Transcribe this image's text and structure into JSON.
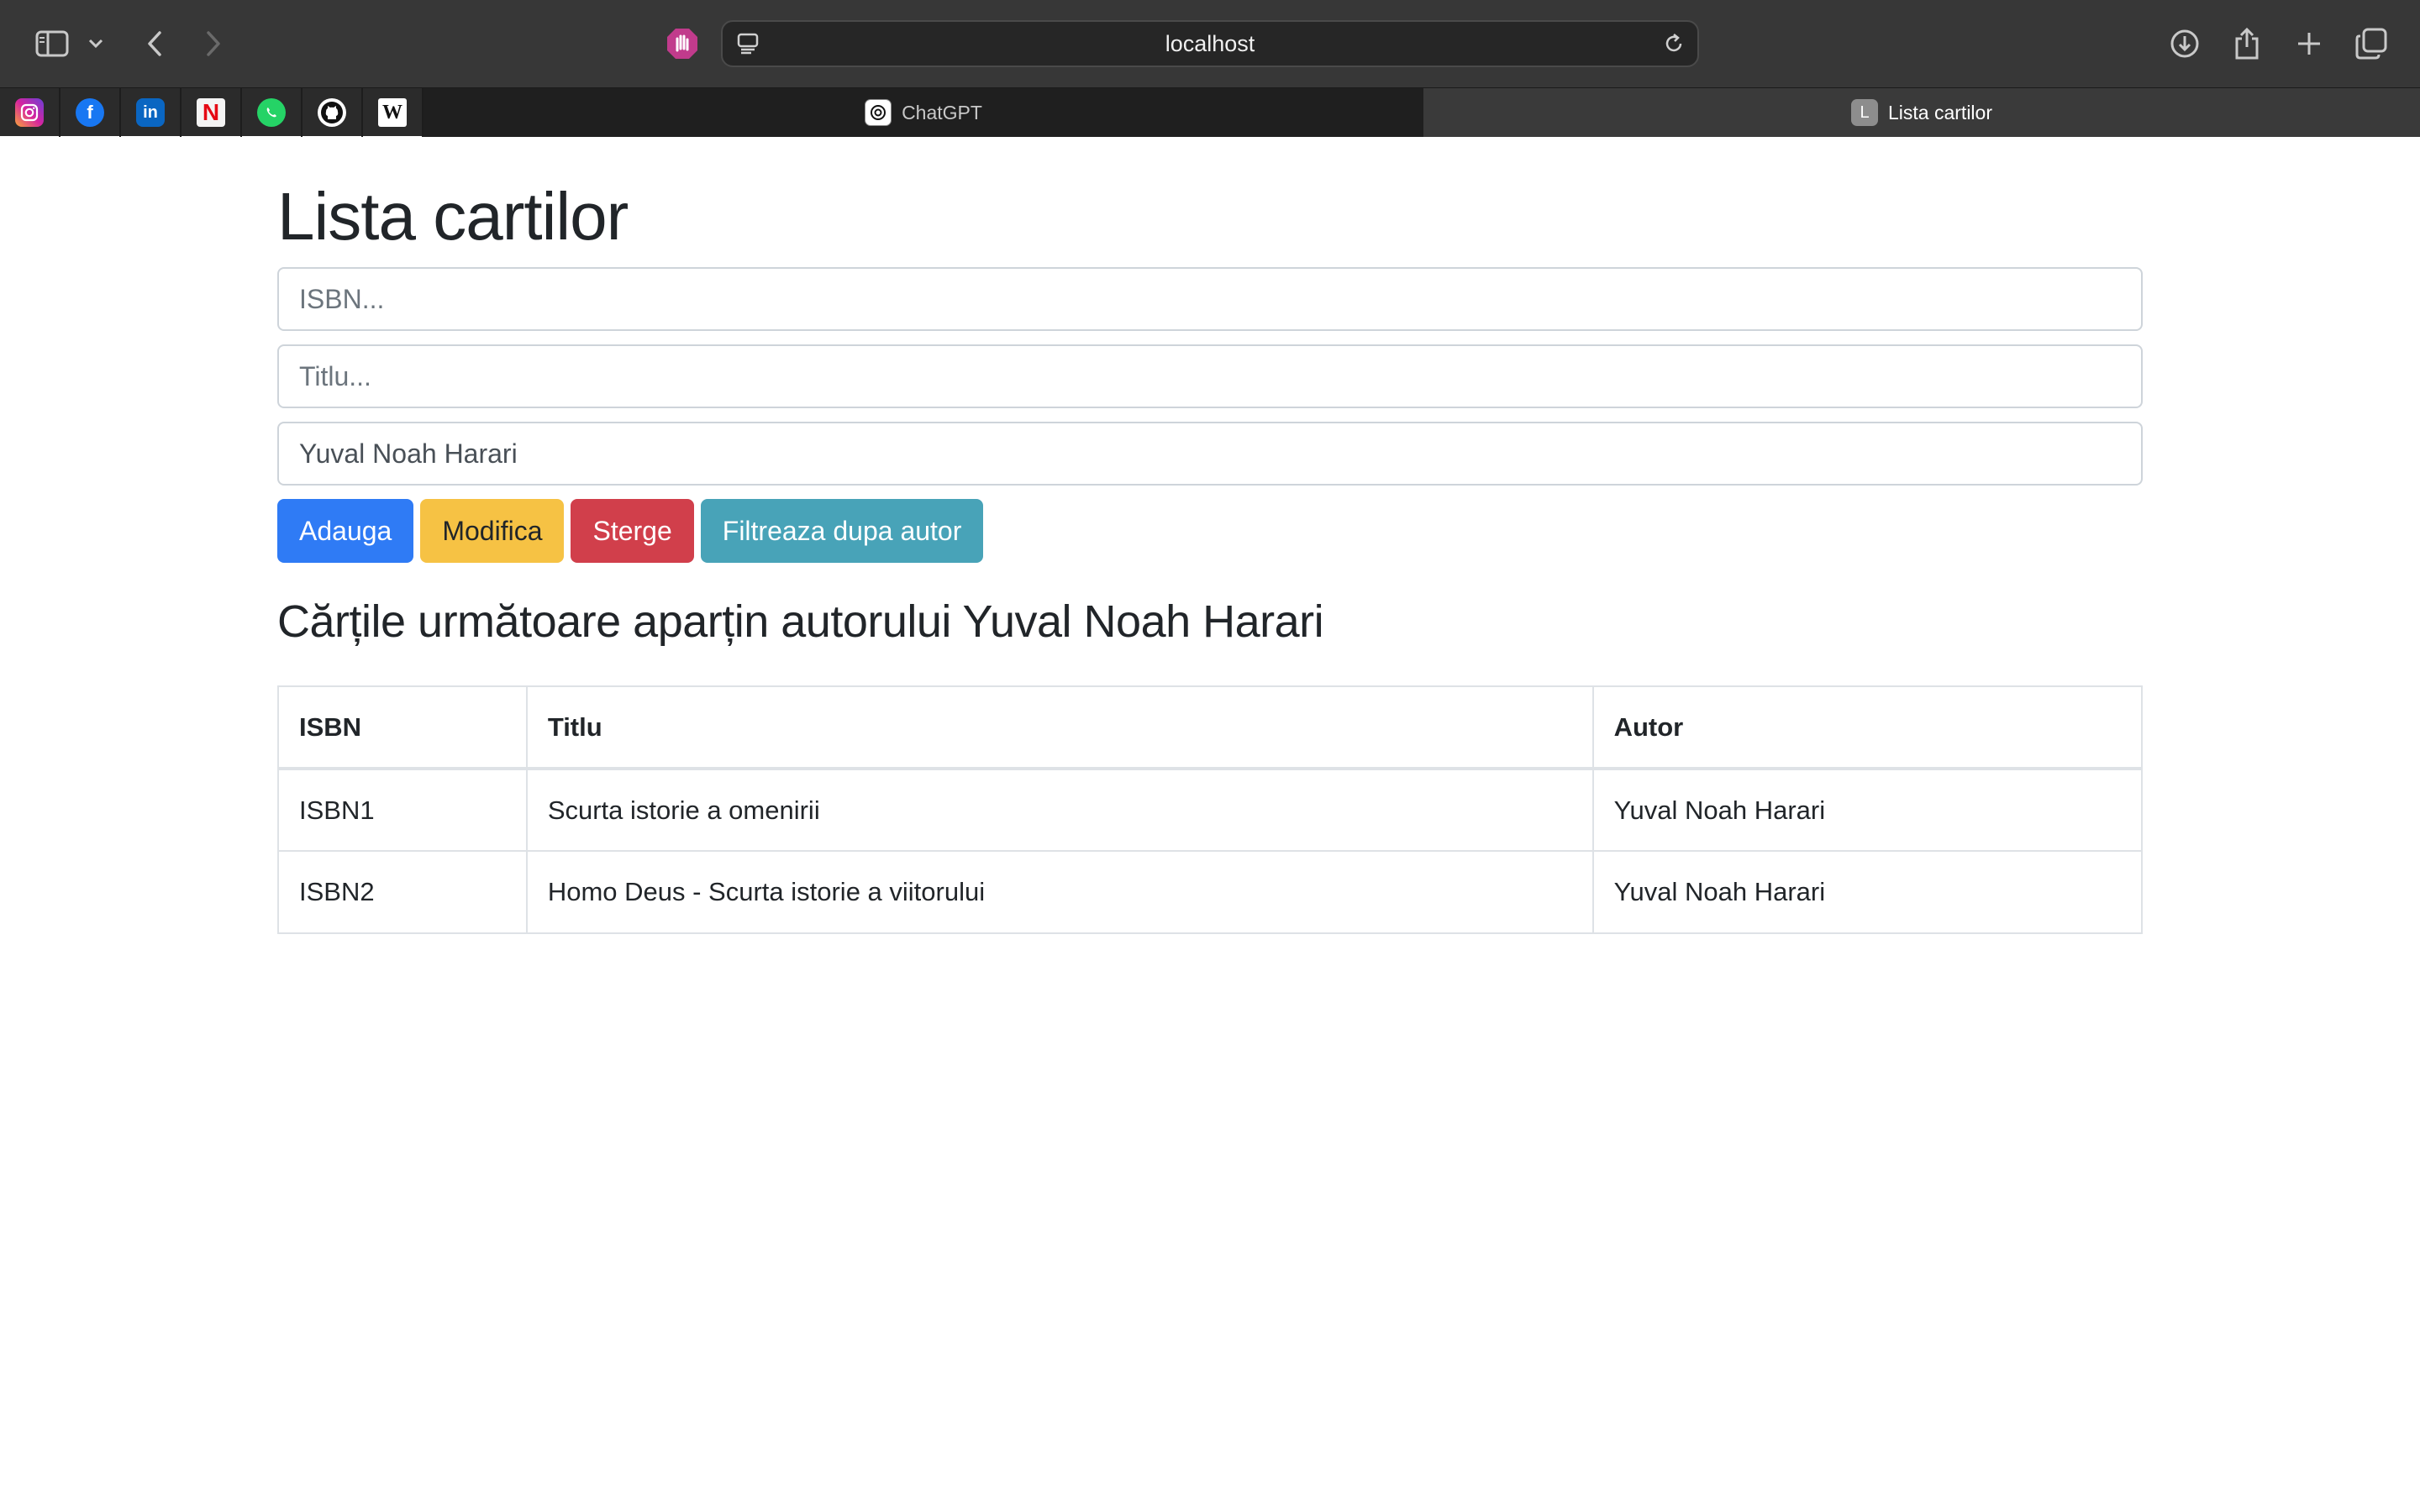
{
  "browser": {
    "url": "localhost",
    "favorites": [
      {
        "name": "instagram",
        "glyph": "◎",
        "color": "#d6249f"
      },
      {
        "name": "facebook",
        "glyph": "f",
        "color": "#1877f2"
      },
      {
        "name": "linkedin",
        "glyph": "in",
        "color": "#0a66c2"
      },
      {
        "name": "netflix",
        "glyph": "N",
        "color": "#e50914"
      },
      {
        "name": "whatsapp",
        "glyph": "✆",
        "color": "#25d366"
      },
      {
        "name": "github",
        "glyph": "●",
        "color": "#111111"
      },
      {
        "name": "wikipedia",
        "glyph": "W",
        "color": "#ffffff"
      }
    ],
    "tabs": [
      {
        "title": "ChatGPT",
        "icon": "chatgpt-icon",
        "active": false
      },
      {
        "title": "Lista cartilor",
        "icon": "L",
        "active": true
      }
    ]
  },
  "page": {
    "title": "Lista cartilor",
    "fields": {
      "isbn_placeholder": "ISBN...",
      "titlu_placeholder": "Titlu...",
      "autor_value": "Yuval Noah Harari"
    },
    "buttons": {
      "add": "Adauga",
      "edit": "Modifica",
      "delete": "Sterge",
      "filter": "Filtreaza dupa autor"
    },
    "subtitle": "Cărțile următoare aparțin autorului Yuval Noah Harari",
    "table": {
      "headers": [
        "ISBN",
        "Titlu",
        "Autor"
      ],
      "rows": [
        [
          "ISBN1",
          "Scurta istorie a omenirii",
          "Yuval Noah Harari"
        ],
        [
          "ISBN2",
          "Homo Deus - Scurta istorie a viitorului",
          "Yuval Noah Harari"
        ]
      ]
    }
  },
  "colors": {
    "primary": "#2f7bf5",
    "warning": "#f6c244",
    "danger": "#d13f4b",
    "info": "#48a3b8"
  }
}
